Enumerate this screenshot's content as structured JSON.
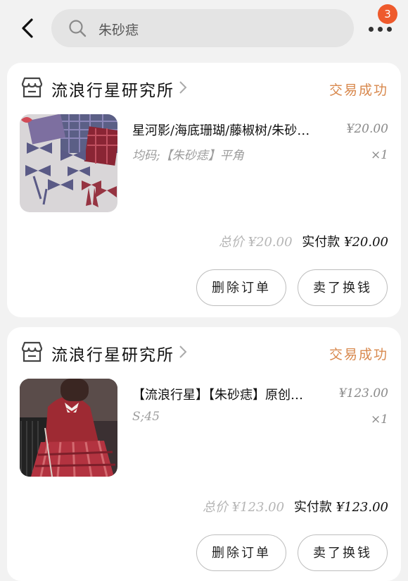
{
  "header": {
    "search_query": "朱砂痣",
    "notification_count": "3",
    "icons": [
      "back-arrow-icon",
      "search-icon",
      "more-dots-icon"
    ]
  },
  "orders": [
    {
      "shop_name": "流浪行星研究所",
      "status": "交易成功",
      "item_title": "星河影/海底珊瑚/藤椒树/朱砂…",
      "item_price": "¥20.00",
      "item_spec": "均码;【朱砂痣】平角",
      "item_qty": "×1",
      "total_label": "总价",
      "total_value": "¥20.00",
      "paid_label": "实付款",
      "paid_value": "¥20.00",
      "delete_label": "删除订单",
      "sell_label": "卖了换钱"
    },
    {
      "shop_name": "流浪行星研究所",
      "status": "交易成功",
      "item_title": "【流浪行星】【朱砂痣】原创…",
      "item_price": "¥123.00",
      "item_spec": "S;45",
      "item_qty": "×1",
      "total_label": "总价",
      "total_value": "¥123.00",
      "paid_label": "实付款",
      "paid_value": "¥123.00",
      "delete_label": "删除订单",
      "sell_label": "卖了换钱"
    }
  ],
  "colors": {
    "status": "#d8884d",
    "badge": "#ee5a2c",
    "background": "#f2f2f2"
  }
}
